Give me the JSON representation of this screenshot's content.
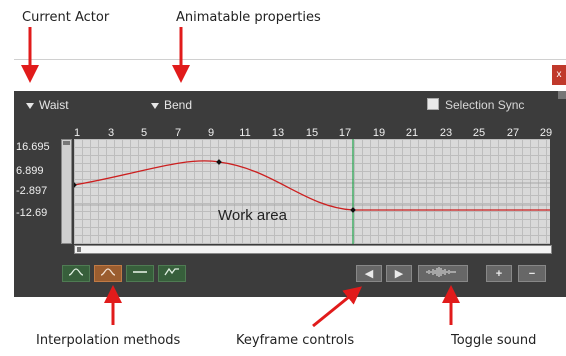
{
  "callouts": {
    "current_actor": "Current Actor",
    "animatable_properties": "Animatable properties",
    "interpolation_methods": "Interpolation methods",
    "keyframe_controls": "Keyframe controls",
    "toggle_sound": "Toggle sound"
  },
  "close_label": "x",
  "toolbar": {
    "actor": "Waist",
    "property": "Bend",
    "selection_sync": "Selection Sync",
    "selection_sync_checked": false
  },
  "timeline": {
    "frames": [
      "1",
      "3",
      "5",
      "7",
      "9",
      "11",
      "13",
      "15",
      "17",
      "19",
      "21",
      "23",
      "25",
      "27",
      "29"
    ],
    "current_frame": 17
  },
  "graph": {
    "y_labels": [
      "16.695",
      "6.899",
      "-2.897",
      "-12.69"
    ],
    "work_area_label": "Work area",
    "curve_color": "#cc1f1f",
    "playhead_color": "#1fa34a",
    "keyframes_frame": [
      1,
      10,
      17
    ]
  },
  "controls": {
    "interpolation": [
      "smooth",
      "smooth-active",
      "constant",
      "linear"
    ],
    "prev_key": "◀",
    "next_key": "▶",
    "sound_icon": "waveform-icon",
    "add_key": "+",
    "remove_key": "−"
  }
}
